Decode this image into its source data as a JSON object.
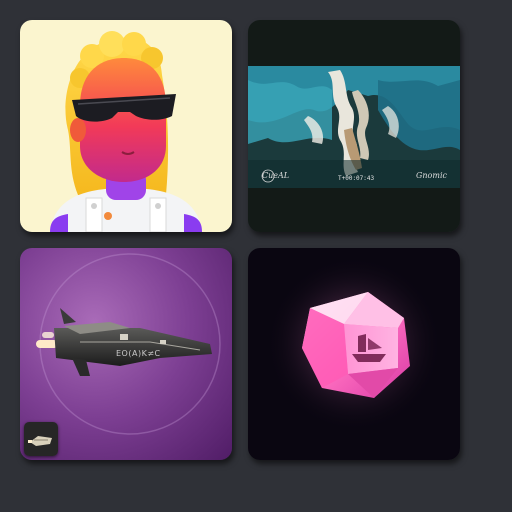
{
  "gallery": {
    "items": [
      {
        "id": "avatar",
        "kind": "image"
      },
      {
        "id": "launch-video",
        "kind": "video",
        "left_badge": "CueAL",
        "timecode": "T+00:07:43",
        "right_badge": "Gnomic"
      },
      {
        "id": "spaceship",
        "kind": "image",
        "hull_text": "EO(A)K≠C",
        "has_thumbnail": true
      },
      {
        "id": "crystal",
        "kind": "image"
      }
    ]
  },
  "colors": {
    "page_background": "#2f3137",
    "avatar_background": "#fbf5cf",
    "video_background": "#131a17",
    "ship_background": "#7a3f8c",
    "crystal_background": "#0a0611",
    "crystal_pink": "#ff7bc6"
  }
}
